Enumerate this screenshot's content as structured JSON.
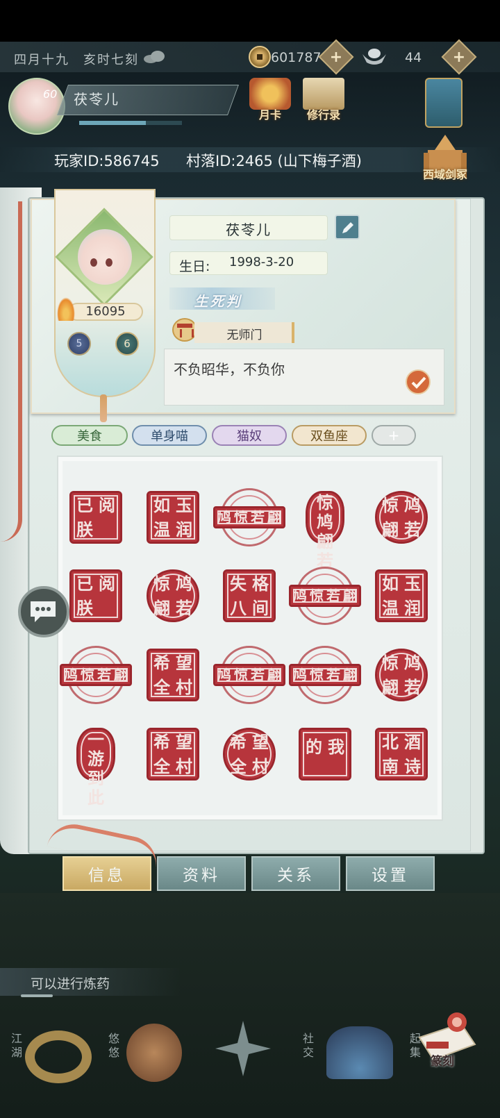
{
  "status_bar": {
    "time": "四月十九　亥时七刻",
    "weather_icon": "cloud-icon",
    "coins": "601787",
    "ingots": "44",
    "plus": "+"
  },
  "player_header": {
    "level": "60",
    "name": "茯苓儿",
    "exp_fraction": 0.65,
    "month_card_label": "月卡",
    "cultivation_label": "修行录",
    "player_id": "玩家ID:586745",
    "village_id": "村落ID:2465 (山下梅子酒)",
    "western_label": "西域剑冢"
  },
  "profile": {
    "power": "16095",
    "badge_1": "5",
    "badge_2": "6",
    "name": "茯苓儿",
    "birthday_label": "生日:",
    "birthday_value": "1998-3-20",
    "sect_badge": "生死判",
    "master": "无师门",
    "signature": "不负昭华，不负你"
  },
  "tags": [
    "美食",
    "单身喵",
    "猫奴",
    "双鱼座"
  ],
  "tag_add": "+",
  "seals": [
    [
      "已",
      "阅",
      "朕",
      ""
    ],
    [
      "如",
      "玉",
      "温",
      "润"
    ],
    [
      "鸠",
      "惊",
      "若",
      "翩"
    ],
    [
      "惊",
      "鸠",
      "翩",
      "若"
    ],
    [
      "惊",
      "鸠",
      "翩",
      "若"
    ],
    [
      "已",
      "阅",
      "朕",
      ""
    ],
    [
      "惊",
      "鸠",
      "翩",
      "若"
    ],
    [
      "失",
      "格",
      "八",
      "间"
    ],
    [
      "鸠",
      "惊",
      "若",
      "翩"
    ],
    [
      "如",
      "玉",
      "温",
      "润"
    ],
    [
      "鸠",
      "惊",
      "若",
      "翩"
    ],
    [
      "希",
      "望",
      "全",
      "村"
    ],
    [
      "鸠",
      "惊",
      "若",
      "翩"
    ],
    [
      "鸠",
      "惊",
      "若",
      "翩"
    ],
    [
      "惊",
      "鸠",
      "翩",
      "若"
    ],
    [
      "一",
      "游",
      "到",
      "此"
    ],
    [
      "希",
      "望",
      "全",
      "村"
    ],
    [
      "希",
      "望",
      "全",
      "村"
    ],
    [
      "的",
      "我",
      "",
      ""
    ],
    [
      "北",
      "酒",
      "南",
      "诗"
    ]
  ],
  "tabs": {
    "info": "信息",
    "data": "资料",
    "relation": "关系",
    "settings": "设置"
  },
  "lower": {
    "task_hint": "可以进行炼药",
    "nav_jianghu": "江湖",
    "nav_youyou": "悠悠",
    "nav_social": "社交",
    "nav_collect": "起集",
    "seal_shortcut": "篆刻"
  }
}
